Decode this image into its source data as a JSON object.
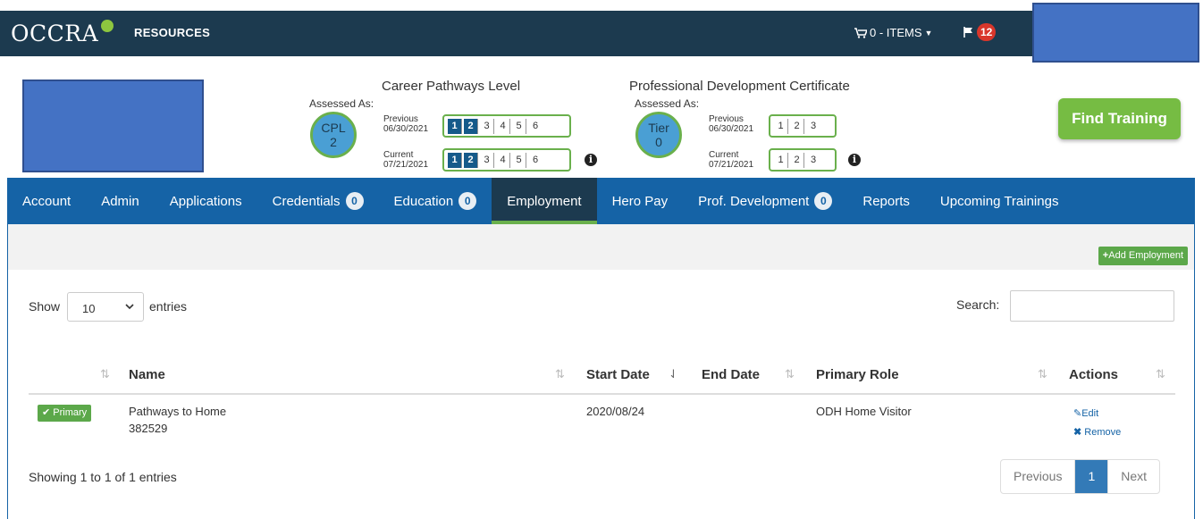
{
  "navbar": {
    "logo": "OCCRA",
    "resources": "RESOURCES",
    "cart": "0 - ITEMS",
    "notifications": "12"
  },
  "career_pathways": {
    "title": "Career Pathways Level",
    "assessed_as": "Assessed As:",
    "badge_line1": "CPL",
    "badge_line2": "2",
    "previous_label": "Previous",
    "previous_date": "06/30/2021",
    "current_label": "Current",
    "current_date": "07/21/2021",
    "levels": [
      "1",
      "2",
      "3",
      "4",
      "5",
      "6"
    ],
    "previous_level": 2,
    "current_level": 2
  },
  "pdc": {
    "title": "Professional Development Certificate",
    "assessed_as": "Assessed As:",
    "badge_line1": "Tier",
    "badge_line2": "0",
    "previous_label": "Previous",
    "previous_date": "06/30/2021",
    "current_label": "Current",
    "current_date": "07/21/2021",
    "levels": [
      "1",
      "2",
      "3"
    ],
    "previous_level": 0,
    "current_level": 0
  },
  "find_training": "Find Training",
  "tabs": [
    {
      "label": "Account"
    },
    {
      "label": "Admin"
    },
    {
      "label": "Applications"
    },
    {
      "label": "Credentials",
      "badge": "0"
    },
    {
      "label": "Education",
      "badge": "0"
    },
    {
      "label": "Employment",
      "active": true
    },
    {
      "label": "Hero Pay"
    },
    {
      "label": "Prof. Development",
      "badge": "0"
    },
    {
      "label": "Reports"
    },
    {
      "label": "Upcoming Trainings"
    }
  ],
  "toolbar": {
    "add_label": "Add Employment"
  },
  "table_controls": {
    "show": "Show",
    "page_size": "10",
    "entries": "entries",
    "search": "Search:"
  },
  "table": {
    "headers": [
      "Name",
      "Start Date",
      "End Date",
      "Primary Role",
      "Actions"
    ],
    "rows": [
      {
        "badge": "Primary",
        "name": "Pathways to Home",
        "id": "382529",
        "start_date": "2020/08/24",
        "end_date": "",
        "role": "ODH Home Visitor",
        "edit": "Edit",
        "remove": "Remove"
      }
    ]
  },
  "footer": {
    "info": "Showing 1 to 1 of 1 entries",
    "previous": "Previous",
    "page": "1",
    "next": "Next"
  },
  "colors": {
    "navbar": "#1c3a4f",
    "tabs": "#1563a6",
    "accent_green": "#6ab04c",
    "level_on": "#155a8a"
  }
}
